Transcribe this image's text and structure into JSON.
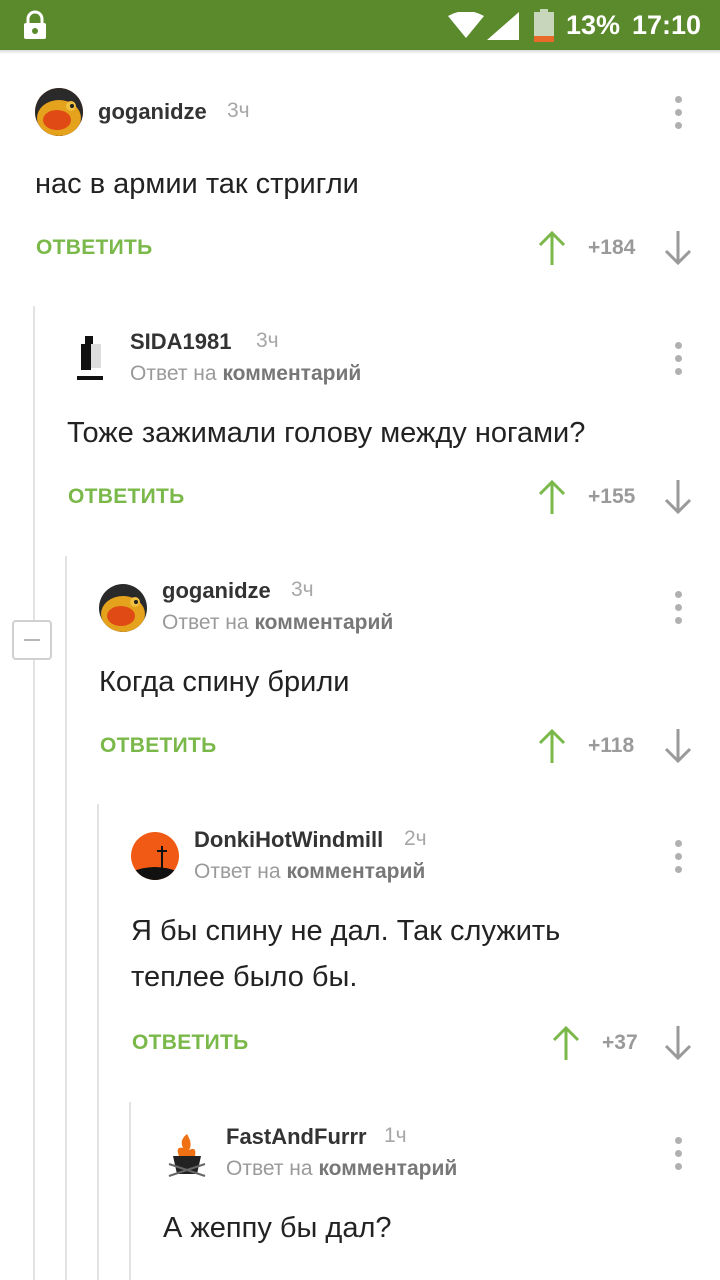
{
  "status_bar": {
    "battery_percent": "13%",
    "time": "17:10",
    "icons": [
      "lock-icon",
      "wifi-icon",
      "signal-icon",
      "battery-icon"
    ],
    "background": "#5a8a2c"
  },
  "accent_color": "#7ab84a",
  "comments": [
    {
      "username": "goganidze",
      "age": "3ч",
      "text": "нас в армии так стригли",
      "reply_label": "ОТВЕТИТЬ",
      "score": "+184"
    },
    {
      "username": "SIDA1981",
      "age": "3ч",
      "reply_to_prefix": "Ответ на",
      "reply_to_target": "комментарий",
      "text": "Тоже зажимали голову между ногами?",
      "reply_label": "ОТВЕТИТЬ",
      "score": "+155"
    },
    {
      "username": "goganidze",
      "age": "3ч",
      "reply_to_prefix": "Ответ на",
      "reply_to_target": "комментарий",
      "text": "Когда спину брили",
      "reply_label": "ОТВЕТИТЬ",
      "score": "+118"
    },
    {
      "username": "DonkiHotWindmill",
      "age": "2ч",
      "reply_to_prefix": "Ответ на",
      "reply_to_target": "комментарий",
      "text_line1": "Я бы спину не дал. Так служить",
      "text_line2": "теплее было бы.",
      "reply_label": "ОТВЕТИТЬ",
      "score": "+37"
    },
    {
      "username": "FastAndFurrr",
      "age": "1ч",
      "reply_to_prefix": "Ответ на",
      "reply_to_target": "комментарий",
      "text": "А жеппу бы дал?"
    }
  ]
}
